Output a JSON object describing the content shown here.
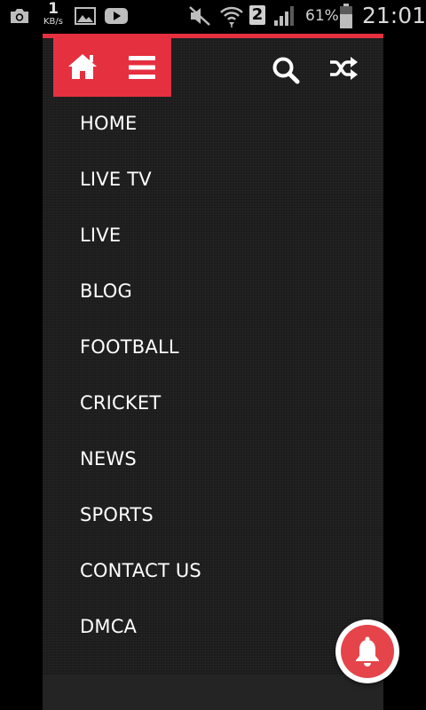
{
  "status_bar": {
    "net_speed_value": "1",
    "net_speed_unit": "KB/s",
    "sim_slot": "2",
    "battery_percent": "61%",
    "time": "21:01"
  },
  "header": {
    "accent_color": "#e5303f",
    "icons": [
      "home-icon",
      "menu-icon",
      "search-icon",
      "shuffle-icon"
    ]
  },
  "menu": {
    "items": [
      {
        "label": "HOME"
      },
      {
        "label": "LIVE TV"
      },
      {
        "label": "LIVE"
      },
      {
        "label": "BLOG"
      },
      {
        "label": "FOOTBALL"
      },
      {
        "label": "CRICKET"
      },
      {
        "label": "NEWS"
      },
      {
        "label": "SPORTS"
      },
      {
        "label": "CONTACT US"
      },
      {
        "label": "DMCA"
      }
    ]
  },
  "notification_button": {
    "icon": "bell-icon",
    "color": "#e5444a"
  }
}
